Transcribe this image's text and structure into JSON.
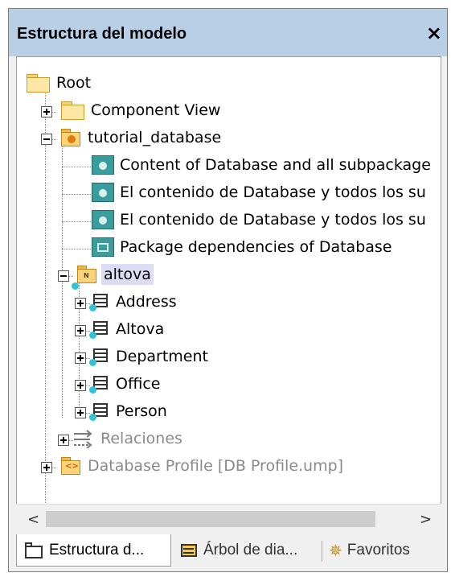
{
  "panel": {
    "title": "Estructura del modelo",
    "close_glyph": "×"
  },
  "tree": {
    "root": "Root",
    "component_view": "Component View",
    "tutorial_database": "tutorial_database",
    "diagrams": [
      "Content of Database and all subpackage",
      "El contenido de Database y todos los su",
      "El contenido de Database y todos los su",
      "Package dependencies of Database"
    ],
    "altova_pkg": "altova",
    "tables": [
      "Address",
      "Altova",
      "Department",
      "Office",
      "Person"
    ],
    "relaciones": "Relaciones",
    "database_profile": "Database Profile [DB Profile.ump]"
  },
  "scrollbar": {
    "left_glyph": "<",
    "right_glyph": ">"
  },
  "tabs": [
    {
      "label": "Estructura d...",
      "active": true
    },
    {
      "label": "Árbol de dia...",
      "active": false
    },
    {
      "label": "Favoritos",
      "active": false
    }
  ],
  "colors": {
    "titlebar": "#b9cfe6",
    "selection": "#dcdcf4",
    "diagram_icon": "#3a9c9c",
    "folder": "#fde7a6"
  }
}
